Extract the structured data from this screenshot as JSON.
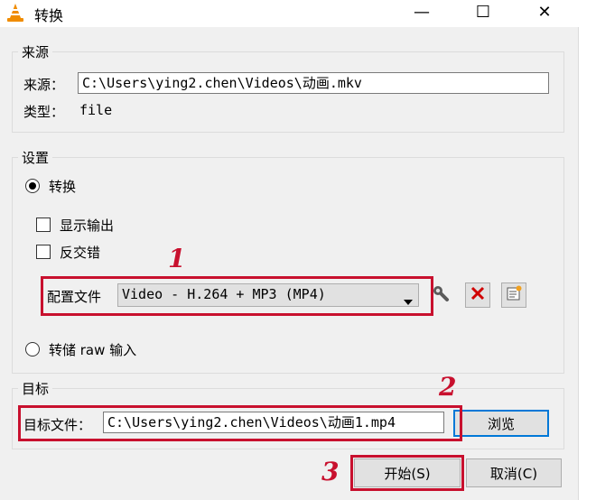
{
  "window": {
    "title": "转换",
    "minimize_glyph": "—",
    "maximize_glyph": "☐",
    "close_glyph": "✕"
  },
  "source": {
    "group_label": "来源",
    "source_label": "来源：",
    "source_value": "C:\\Users\\ying2.chen\\Videos\\动画.mkv",
    "type_label": "类型：",
    "type_value": "file"
  },
  "settings": {
    "group_label": "设置",
    "convert_label": "转换",
    "show_output_label": "显示输出",
    "deinterlace_label": "反交错",
    "profile_label": "配置文件",
    "profile_value": "Video - H.264 + MP3 (MP4)",
    "dump_raw_label": "转储 raw 输入"
  },
  "destination": {
    "group_label": "目标",
    "file_label": "目标文件：",
    "file_value": "C:\\Users\\ying2.chen\\Videos\\动画1.mp4",
    "browse_label": "浏览"
  },
  "footer": {
    "start_label": "开始(S)",
    "cancel_label": "取消(C)"
  },
  "annotations": {
    "n1": "1",
    "n2": "2",
    "n3": "3"
  },
  "colors": {
    "annotation_red": "#c8102e",
    "vlc_orange": "#f08c00",
    "delete_red": "#d00000"
  },
  "icons": [
    "vlc-cone-icon",
    "wrench-icon",
    "delete-x-icon",
    "new-profile-icon",
    "dropdown-arrow-icon"
  ]
}
